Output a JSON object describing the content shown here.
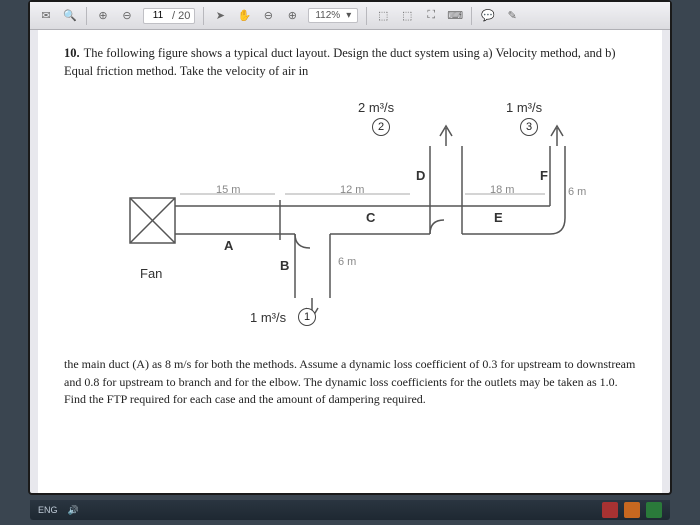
{
  "toolbar": {
    "page_current": "11",
    "page_total": "/ 20",
    "zoom": "112%"
  },
  "problem": {
    "number": "10.",
    "intro": "The following figure shows a typical duct layout. Design the duct system using a) Velocity method, and b) Equal friction method. Take the velocity of air in"
  },
  "diagram": {
    "flows": {
      "outlet2": "2 m³/s",
      "outlet3": "1 m³/s",
      "outlet1": "1 m³/s"
    },
    "outlet_numbers": {
      "o1": "1",
      "o2": "2",
      "o3": "3"
    },
    "segments": {
      "A": "A",
      "B": "B",
      "C": "C",
      "D": "D",
      "E": "E",
      "F": "F"
    },
    "lengths": {
      "l15": "15 m",
      "l12": "12 m",
      "l18": "18 m",
      "l6r": "6 m",
      "l6b": "6 m"
    },
    "fan_label": "Fan"
  },
  "footer": {
    "text": "the main duct (A) as 8 m/s for both the methods. Assume a dynamic loss coefficient of 0.3 for upstream to downstream and 0.8 for upstream to branch and for the elbow. The dynamic loss coefficients for the outlets may be taken as 1.0. Find the FTP required for each case and the amount of dampering required."
  },
  "taskbar": {
    "lang": "ENG"
  }
}
